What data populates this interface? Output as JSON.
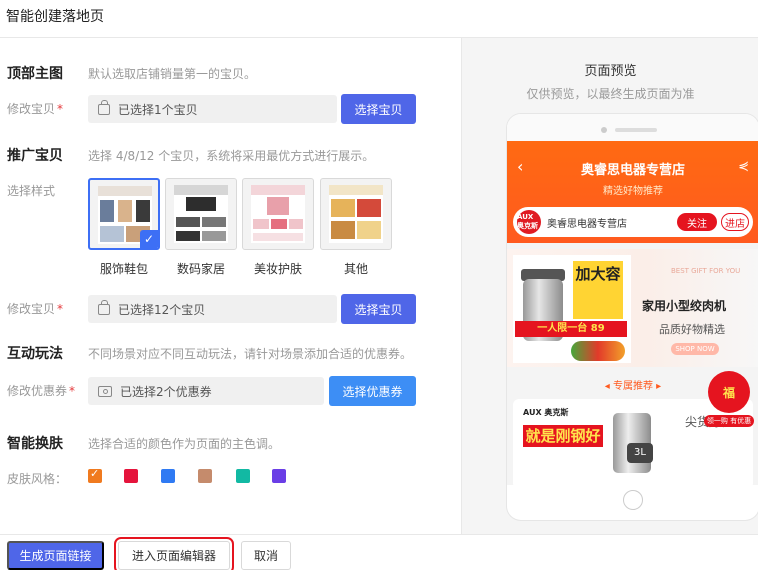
{
  "page": {
    "title": "智能创建落地页"
  },
  "hero_section": {
    "title": "顶部主图",
    "hint": "默认选取店铺销量第一的宝贝。",
    "field_label": "修改宝贝",
    "value": "已选择1个宝贝",
    "button": "选择宝贝"
  },
  "promo_section": {
    "title": "推广宝贝",
    "hint": "选择 4/8/12 个宝贝，系统将采用最优方式进行展示。",
    "style_label": "选择样式",
    "styles": [
      {
        "name": "服饰鞋包",
        "selected": true
      },
      {
        "name": "数码家居",
        "selected": false
      },
      {
        "name": "美妆护肤",
        "selected": false
      },
      {
        "name": "其他",
        "selected": false
      }
    ],
    "field_label": "修改宝贝",
    "value": "已选择12个宝贝",
    "button": "选择宝贝"
  },
  "interaction_section": {
    "title": "互动玩法",
    "hint": "不同场景对应不同互动玩法，请针对场景添加合适的优惠券。",
    "field_label": "修改优惠券",
    "value": "已选择2个优惠券",
    "button": "选择优惠券"
  },
  "skin_section": {
    "title": "智能换肤",
    "hint": "选择合适的颜色作为页面的主色调。",
    "field_label": "皮肤风格：",
    "colors": [
      "#f07a1f",
      "#e5143c",
      "#2f7af3",
      "#c58b6c",
      "#12b9a3",
      "#6a3ee6"
    ],
    "selected_index": 0
  },
  "footer": {
    "generate": "生成页面链接",
    "editor": "进入页面编辑器",
    "cancel": "取消"
  },
  "preview": {
    "title": "页面预览",
    "subtitle": "仅供预览，以最终生成页面为准",
    "store_title": "奥睿思电器专营店",
    "store_sub": "精选好物推荐",
    "shop_logo": "AUX 奥克斯",
    "shop_name": "奥睿思电器专营店",
    "follow": "关注",
    "enter": "进店",
    "banner_yellow": "加大容",
    "banner_red": "一人限一台 89",
    "banner_en": "BEST GIFT FOR YOU",
    "banner_label": "家用小型绞肉机",
    "banner_sub": "品质好物精选",
    "banner_pill": "SHOP NOW",
    "rec_title": "专属推荐",
    "card_brand": "AUX 奥克斯",
    "card_red": "就是刚钢好",
    "card_3l": "3L",
    "card_right": "尖货好价",
    "float_main": "福",
    "float_cap": "领一购 有优惠"
  }
}
